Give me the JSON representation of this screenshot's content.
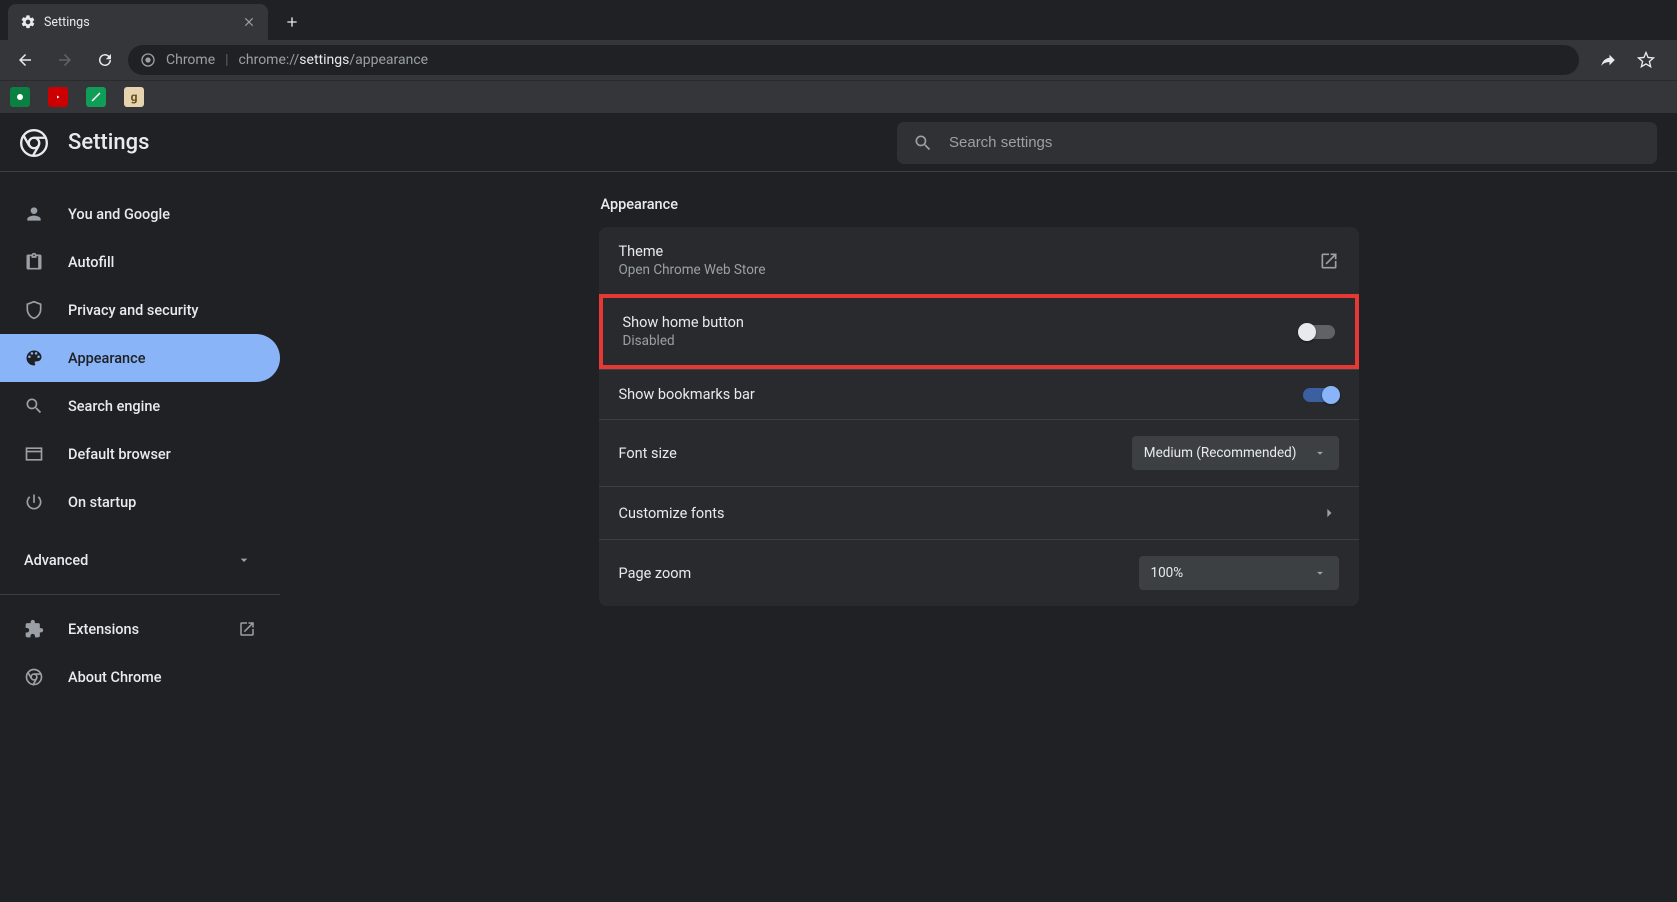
{
  "browser": {
    "tab_title": "Settings",
    "url_host": "Chrome",
    "url_prefix": "chrome://",
    "url_strong": "settings",
    "url_suffix": "/appearance"
  },
  "header": {
    "title": "Settings",
    "search_placeholder": "Search settings"
  },
  "sidebar": {
    "items": [
      {
        "id": "you-and-google",
        "label": "You and Google"
      },
      {
        "id": "autofill",
        "label": "Autofill"
      },
      {
        "id": "privacy",
        "label": "Privacy and security"
      },
      {
        "id": "appearance",
        "label": "Appearance"
      },
      {
        "id": "search-engine",
        "label": "Search engine"
      },
      {
        "id": "default-browser",
        "label": "Default browser"
      },
      {
        "id": "on-startup",
        "label": "On startup"
      }
    ],
    "advanced_label": "Advanced",
    "extensions_label": "Extensions",
    "about_label": "About Chrome"
  },
  "main": {
    "section_title": "Appearance",
    "theme": {
      "primary": "Theme",
      "secondary": "Open Chrome Web Store"
    },
    "home_button": {
      "primary": "Show home button",
      "secondary": "Disabled",
      "on": false
    },
    "bookmarks_bar": {
      "primary": "Show bookmarks bar",
      "on": true
    },
    "font_size": {
      "primary": "Font size",
      "value": "Medium (Recommended)"
    },
    "customize_fonts": {
      "primary": "Customize fonts"
    },
    "page_zoom": {
      "primary": "Page zoom",
      "value": "100%"
    }
  }
}
